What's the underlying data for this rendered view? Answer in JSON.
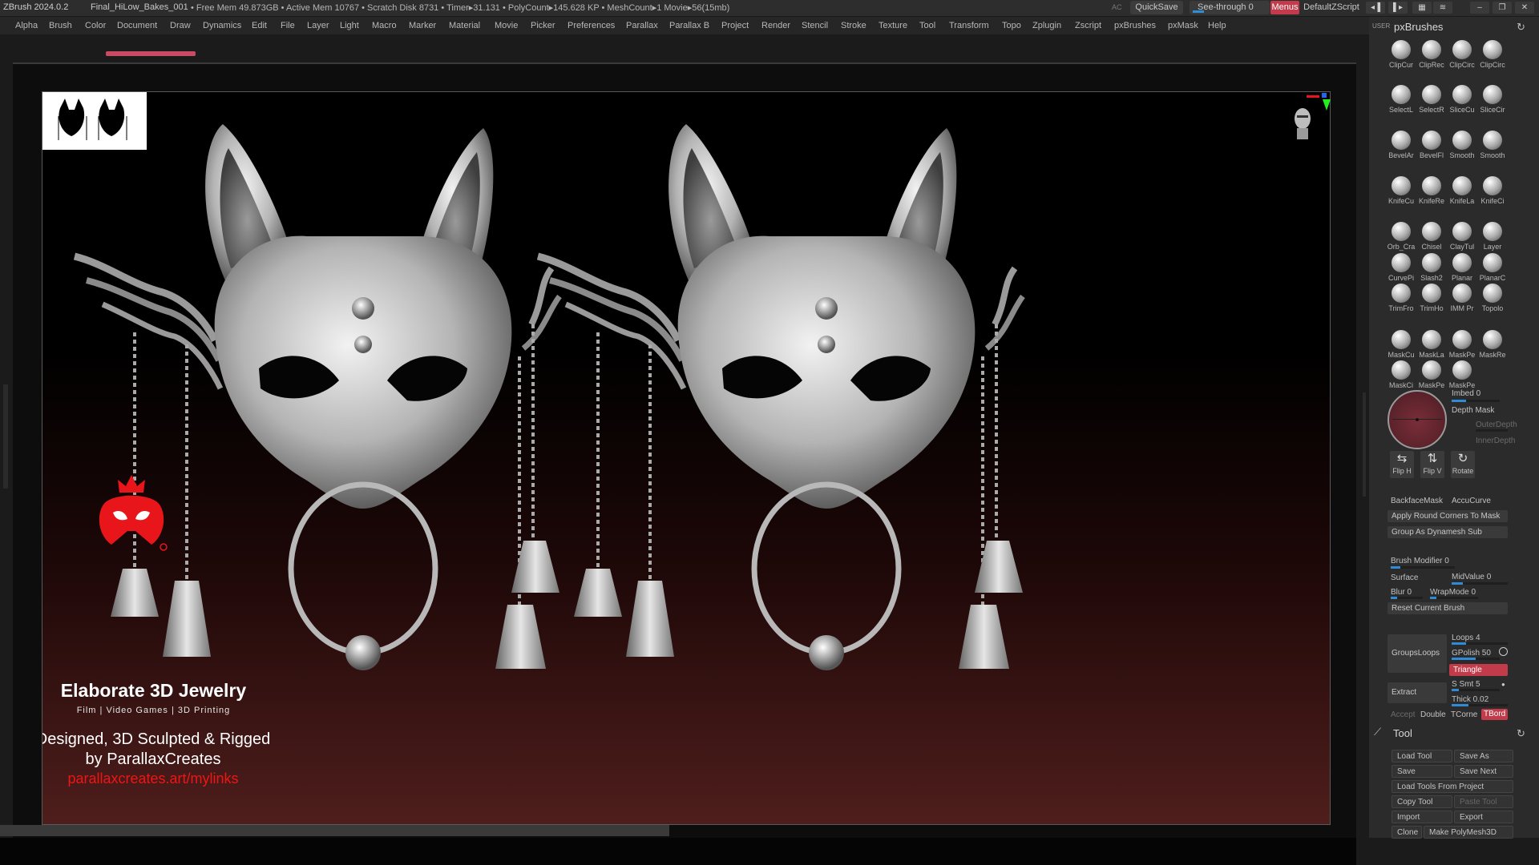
{
  "titlebar": {
    "app": "ZBrush 2024.0.2",
    "file": "Final_HiLow_Bakes_001",
    "stats": "• Free Mem 49.873GB • Active Mem 10767 • Scratch Disk 8731 • Timer▸31.131 • PolyCount▸145.628 KP • MeshCount▸1 Movie▸56(15mb)",
    "ac": "AC",
    "quicksave": "QuickSave",
    "see_through": "See-through  0",
    "menus": "Menus",
    "default_zscript": "DefaultZScript"
  },
  "menubar": {
    "items": [
      "Alpha",
      "Brush",
      "Color",
      "Document",
      "Draw",
      "Dynamics",
      "Edit",
      "File",
      "Layer",
      "Light",
      "Macro",
      "Marker",
      "Material",
      "Movie",
      "Picker",
      "Preferences",
      "Parallax",
      "Parallax B",
      "Project",
      "Render",
      "Stencil",
      "Stroke",
      "Texture",
      "Tool",
      "Transform",
      "Topo",
      "Zplugin",
      "Zscript",
      "pxBrushes",
      "pxMask",
      "Help"
    ]
  },
  "viewport": {
    "title": "Elaborate 3D Jewelry",
    "subtitle": "Film | Video Games | 3D Printing",
    "credit_line1": "Designed, 3D Sculpted & Rigged",
    "credit_line2": "by ParallaxCreates",
    "link": "parallaxcreates.art/mylinks",
    "colors": {
      "link": "#f01515",
      "logo": "#e8161a"
    }
  },
  "palette": {
    "user_label": "USER",
    "title": "pxBrushes",
    "brush_rows": [
      [
        "ClipCur",
        "ClipRec",
        "ClipCirc",
        "ClipCirc"
      ],
      [
        "SelectL",
        "SelectR",
        "SliceCu",
        "SliceCir"
      ],
      [
        "BevelAr",
        "BevelFl",
        "Smooth",
        "Smooth"
      ],
      [
        "KnifeCu",
        "KnifeRe",
        "KnifeLa",
        "KnifeCi"
      ],
      [
        "Orb_Cra",
        "Chisel",
        "ClayTul",
        "Layer"
      ],
      [
        "CurvePi",
        "Slash2",
        "Planar",
        "PlanarC"
      ],
      [
        "TrimFro",
        "TrimHo",
        "IMM Pr",
        "Topolo"
      ],
      [
        "MaskCu",
        "MaskLa",
        "MaskPe",
        "MaskRe"
      ],
      [
        "MaskCi",
        "MaskPe",
        "MaskPe"
      ]
    ],
    "imbed": "Imbed 0",
    "depth_mask": "Depth Mask",
    "outer_depth": "OuterDepth",
    "inner_depth": "InnerDepth",
    "flip_h": "Flip H",
    "flip_v": "Flip V",
    "rotate": "Rotate",
    "backface_mask": "BackfaceMask",
    "accu_curve": "AccuCurve",
    "apply_round_corners": "Apply Round Corners To Mask",
    "group_as_dynamesh": "Group As Dynamesh Sub",
    "brush_modifier": "Brush Modifier 0",
    "surface": "Surface",
    "midvalue": "MidValue 0",
    "blur": "Blur 0",
    "wrapmode": "WrapMode 0",
    "reset_current_brush": "Reset Current Brush",
    "groups_loops": "GroupsLoops",
    "loops": "Loops 4",
    "gpolish": "GPolish 50",
    "triangle": "Triangle",
    "extract": "Extract",
    "ssmt": "S Smt 5",
    "thick": "Thick 0.02",
    "accept": "Accept",
    "double": "Double",
    "tcorne": "TCorne",
    "tbord": "TBord",
    "slider_levels": {
      "imbed": 0.3,
      "brush_modifier": 0.15,
      "midvalue": 0.2,
      "loops": 0.25,
      "gpolish": 0.5,
      "ssmt": 0.15,
      "thick": 0.3
    }
  },
  "tool": {
    "title": "Tool",
    "buttons": [
      {
        "label": "Load Tool",
        "enabled": true
      },
      {
        "label": "Save As",
        "enabled": true
      },
      {
        "label": "Save",
        "enabled": true
      },
      {
        "label": "Save Next",
        "enabled": true
      },
      {
        "label": "Load Tools From Project",
        "enabled": true
      },
      {
        "label": "Copy Tool",
        "enabled": true
      },
      {
        "label": "Paste Tool",
        "enabled": false
      },
      {
        "label": "Import",
        "enabled": true
      },
      {
        "label": "Export",
        "enabled": true
      },
      {
        "label": "Clone",
        "enabled": true
      },
      {
        "label": "Make PolyMesh3D",
        "enabled": true
      }
    ]
  }
}
